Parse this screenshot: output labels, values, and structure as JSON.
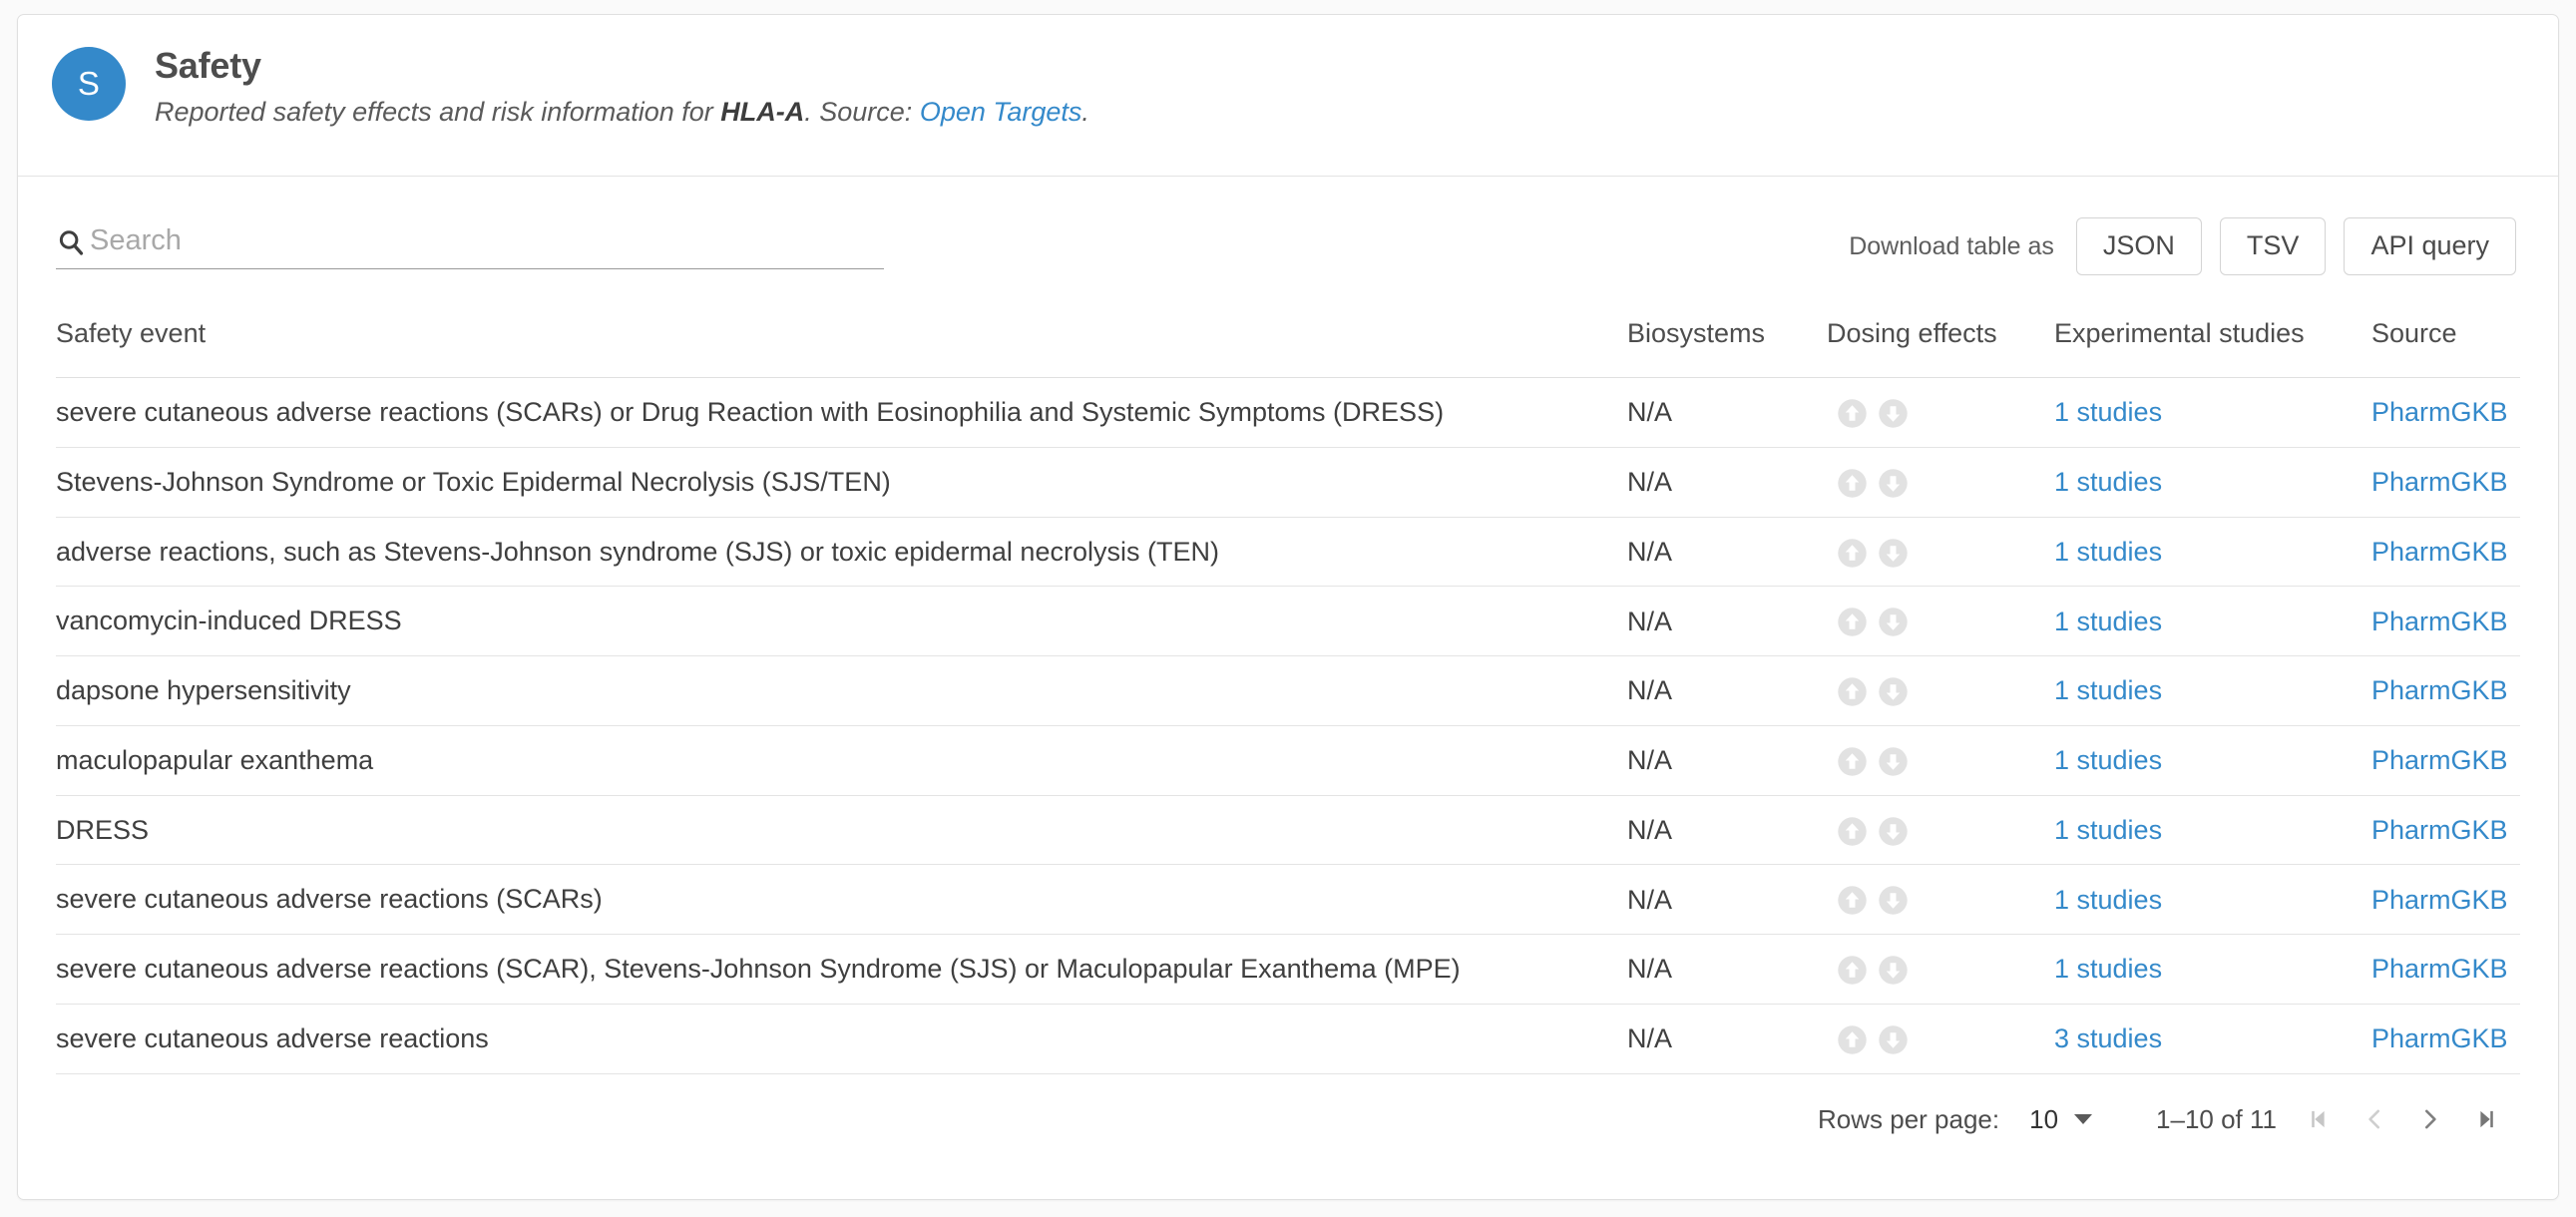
{
  "header": {
    "avatar_letter": "S",
    "title": "Safety",
    "subtitle_prefix": "Reported safety effects and risk information for ",
    "gene": "HLA-A",
    "subtitle_mid": ". Source: ",
    "source_link": "Open Targets",
    "subtitle_suffix": ".",
    "accent_color": "#3489ca"
  },
  "search": {
    "placeholder": "Search",
    "value": "",
    "icon": "search-icon"
  },
  "toolbar": {
    "download_label": "Download table as",
    "buttons": [
      {
        "label": "JSON",
        "name": "download-json-button"
      },
      {
        "label": "TSV",
        "name": "download-tsv-button"
      },
      {
        "label": "API query",
        "name": "api-query-button"
      }
    ]
  },
  "table": {
    "columns": [
      "Safety event",
      "Biosystems",
      "Dosing effects",
      "Experimental studies",
      "Source"
    ],
    "rows": [
      {
        "event": "severe cutaneous adverse reactions (SCARs) or Drug Reaction with Eosinophilia and Systemic Symptoms (DRESS)",
        "biosystems": "N/A",
        "dosing": [
          "arrow-up-circle-icon",
          "arrow-down-circle-icon"
        ],
        "studies": "1 studies",
        "source": "PharmGKB"
      },
      {
        "event": "Stevens-Johnson Syndrome or Toxic Epidermal Necrolysis (SJS/TEN)",
        "biosystems": "N/A",
        "dosing": [
          "arrow-up-circle-icon",
          "arrow-down-circle-icon"
        ],
        "studies": "1 studies",
        "source": "PharmGKB"
      },
      {
        "event": "adverse reactions, such as Stevens-Johnson syndrome (SJS) or toxic epidermal necrolysis (TEN)",
        "biosystems": "N/A",
        "dosing": [
          "arrow-up-circle-icon",
          "arrow-down-circle-icon"
        ],
        "studies": "1 studies",
        "source": "PharmGKB"
      },
      {
        "event": "vancomycin-induced DRESS",
        "biosystems": "N/A",
        "dosing": [
          "arrow-up-circle-icon",
          "arrow-down-circle-icon"
        ],
        "studies": "1 studies",
        "source": "PharmGKB"
      },
      {
        "event": "dapsone hypersensitivity",
        "biosystems": "N/A",
        "dosing": [
          "arrow-up-circle-icon",
          "arrow-down-circle-icon"
        ],
        "studies": "1 studies",
        "source": "PharmGKB"
      },
      {
        "event": "maculopapular exanthema",
        "biosystems": "N/A",
        "dosing": [
          "arrow-up-circle-icon",
          "arrow-down-circle-icon"
        ],
        "studies": "1 studies",
        "source": "PharmGKB"
      },
      {
        "event": "DRESS",
        "biosystems": "N/A",
        "dosing": [
          "arrow-up-circle-icon",
          "arrow-down-circle-icon"
        ],
        "studies": "1 studies",
        "source": "PharmGKB"
      },
      {
        "event": "severe cutaneous adverse reactions (SCARs)",
        "biosystems": "N/A",
        "dosing": [
          "arrow-up-circle-icon",
          "arrow-down-circle-icon"
        ],
        "studies": "1 studies",
        "source": "PharmGKB"
      },
      {
        "event": "severe cutaneous adverse reactions (SCAR), Stevens-Johnson Syndrome (SJS) or Maculopapular Exanthema (MPE)",
        "biosystems": "N/A",
        "dosing": [
          "arrow-up-circle-icon",
          "arrow-down-circle-icon"
        ],
        "studies": "1 studies",
        "source": "PharmGKB"
      },
      {
        "event": "severe cutaneous adverse reactions",
        "biosystems": "N/A",
        "dosing": [
          "arrow-up-circle-icon",
          "arrow-down-circle-icon"
        ],
        "studies": "3 studies",
        "source": "PharmGKB"
      }
    ]
  },
  "pagination": {
    "rows_per_page_label": "Rows per page:",
    "rows_per_page_value": "10",
    "range_label": "1–10 of 11",
    "first_page_icon": "first-page-icon",
    "prev_page_icon": "previous-page-icon",
    "next_page_icon": "next-page-icon",
    "last_page_icon": "last-page-icon"
  }
}
